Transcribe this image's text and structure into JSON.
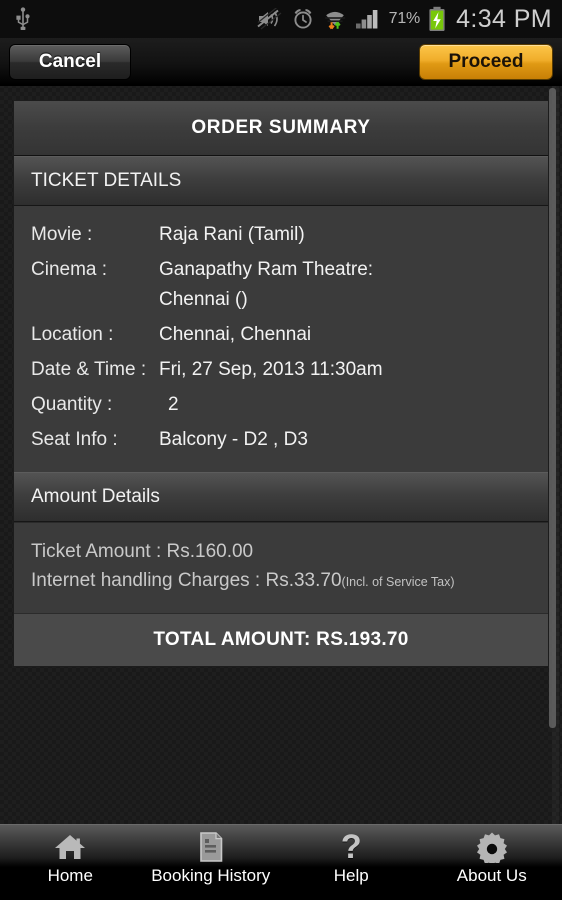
{
  "status_bar": {
    "usb_icon": "usb-icon",
    "silent_icon": "mute-volume-icon",
    "alarm_icon": "alarm-clock-icon",
    "wifi_icon": "wifi-data-transfer-icon",
    "signal_icon": "cellular-signal-icon",
    "battery_percent": "71%",
    "battery_icon": "battery-charging-icon",
    "clock": "4:34 PM"
  },
  "action_bar": {
    "cancel_label": "Cancel",
    "proceed_label": "Proceed",
    "proceed_color": "#f0ad2a"
  },
  "order": {
    "card_title": "ORDER SUMMARY",
    "ticket_section_title": "TICKET DETAILS",
    "ticket_rows": [
      {
        "label": "Movie :",
        "value": "Raja Rani (Tamil)"
      },
      {
        "label": "Cinema :",
        "value": "Ganapathy Ram Theatre:\nChennai ()"
      },
      {
        "label": "Location :",
        "value": "Chennai, Chennai"
      },
      {
        "label": "Date & Time :",
        "value": "Fri, 27 Sep, 2013  11:30am"
      },
      {
        "label": "Quantity :",
        "value": "2"
      },
      {
        "label": "Seat Info :",
        "value": "Balcony - D2 , D3"
      }
    ],
    "amount_section_title": "Amount Details",
    "ticket_amount_line": "Ticket Amount : Rs.160.00",
    "handling_line": "Internet handling Charges : Rs.33.70",
    "handling_note": "(Incl. of Service Tax)",
    "total_label": "TOTAL AMOUNT: RS.193.70"
  },
  "bottom_nav": {
    "items": [
      {
        "label": "Home",
        "icon": "home-icon"
      },
      {
        "label": "Booking History",
        "icon": "document-icon"
      },
      {
        "label": "Help",
        "icon": "question-mark-icon"
      },
      {
        "label": "About Us",
        "icon": "gear-icon"
      }
    ]
  }
}
